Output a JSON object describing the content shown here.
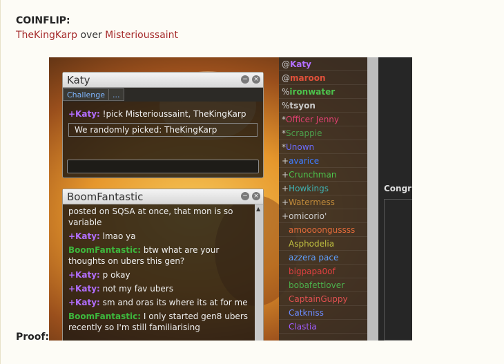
{
  "post": {
    "title": "COINFLIP:",
    "winner": "TheKingKarp",
    "connector": " over ",
    "loser": "Misterioussaint",
    "proof_label": "Proof:"
  },
  "katy_panel": {
    "title": "Katy",
    "tab_challenge": "Challenge",
    "tab_more": "...",
    "messages": [
      {
        "user": "+Katy:",
        "text": "!pick Misterioussaint, TheKingKarp"
      }
    ],
    "picked_text": "We randomly picked:  TheKingKarp"
  },
  "boom_panel": {
    "title": "BoomFantastic",
    "messages": [
      {
        "user": "",
        "text": "posted on SQSA at once, that mon is so variable"
      },
      {
        "user": "+Katy:",
        "text": "lmao ya"
      },
      {
        "user": "BoomFantastic:",
        "text": "btw what are your thoughts on ubers this gen?"
      },
      {
        "user": "+Katy:",
        "text": "p okay"
      },
      {
        "user": "+Katy:",
        "text": "not my fav ubers"
      },
      {
        "user": "+Katy:",
        "text": "sm and oras its where its at for me"
      },
      {
        "user": "BoomFantastic:",
        "text": "I only started gen8 ubers recently so I'm still familiarising"
      }
    ]
  },
  "userlist": [
    {
      "rank": "@",
      "name": "Katy",
      "color": "#b26eff",
      "bold": true
    },
    {
      "rank": "@",
      "name": "maroon",
      "color": "#e0503a",
      "bold": true
    },
    {
      "rank": "%",
      "name": "ironwater",
      "color": "#4cc24c",
      "bold": true
    },
    {
      "rank": "%",
      "name": "tsyon",
      "color": "#cccccc",
      "bold": true
    },
    {
      "rank": "*",
      "name": "Officer Jenny",
      "color": "#e04070",
      "bold": false
    },
    {
      "rank": "*",
      "name": "Scrappie",
      "color": "#4ca04c",
      "bold": false
    },
    {
      "rank": "*",
      "name": "Unown",
      "color": "#6c6cff",
      "bold": false
    },
    {
      "rank": "+",
      "name": "avarice",
      "color": "#3f7cff",
      "bold": false
    },
    {
      "rank": "+",
      "name": "Crunchman",
      "color": "#4cc24c",
      "bold": false
    },
    {
      "rank": "+",
      "name": "Howkings",
      "color": "#3fb0b0",
      "bold": false
    },
    {
      "rank": "+",
      "name": "Watermess",
      "color": "#c08a3a",
      "bold": false
    },
    {
      "rank": "+",
      "name": "omicorio'",
      "color": "#cccccc",
      "bold": false
    },
    {
      "rank": "",
      "name": "amoooongussss",
      "color": "#e06a3a",
      "bold": false
    },
    {
      "rank": "",
      "name": "Asphodelia",
      "color": "#c0c040",
      "bold": false
    },
    {
      "rank": "",
      "name": "azzera pace",
      "color": "#5fa0ff",
      "bold": false
    },
    {
      "rank": "",
      "name": "bigpapa0of",
      "color": "#e04040",
      "bold": false
    },
    {
      "rank": "",
      "name": "bobafettlover",
      "color": "#4cb04c",
      "bold": false
    },
    {
      "rank": "",
      "name": "CaptainGuppy",
      "color": "#e05050",
      "bold": false
    },
    {
      "rank": "",
      "name": "Catkniss",
      "color": "#6c8cff",
      "bold": false
    },
    {
      "rank": "",
      "name": "Clastia",
      "color": "#a05cff",
      "bold": false
    }
  ],
  "right_panel": {
    "heading": "Congr"
  },
  "colors": {
    "link_red": "#a52a2a",
    "katy_purple": "#b26eff",
    "boom_green": "#3db83d"
  }
}
